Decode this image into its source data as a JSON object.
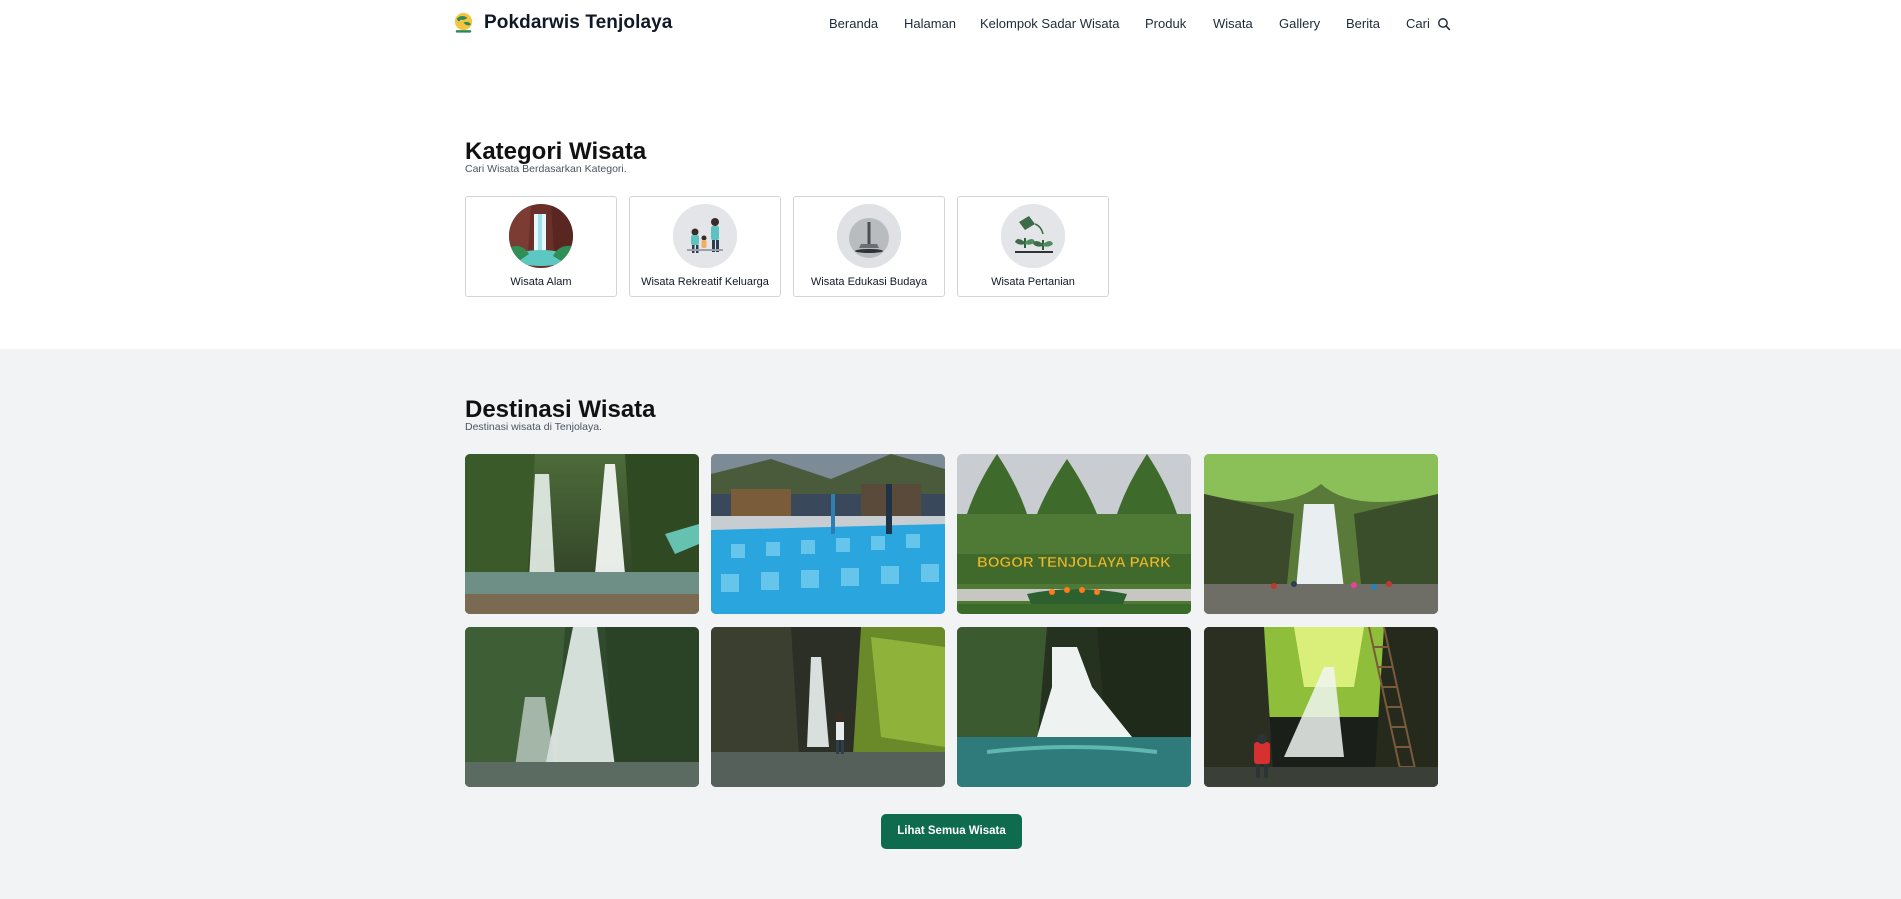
{
  "brand": {
    "name": "Pokdarwis Tenjolaya",
    "logo_icon": "globe-leaf-icon"
  },
  "nav": {
    "items": [
      "Beranda",
      "Halaman",
      "Kelompok Sadar Wisata",
      "Produk",
      "Wisata",
      "Gallery",
      "Berita",
      "Cari"
    ],
    "search_icon": "search-icon"
  },
  "kategori": {
    "title": "Kategori Wisata",
    "subtitle": "Cari Wisata Berdasarkan Kategori.",
    "items": [
      {
        "label": "Wisata Alam",
        "icon": "waterfall-icon"
      },
      {
        "label": "Wisata Rekreatif Keluarga",
        "icon": "family-icon"
      },
      {
        "label": "Wisata Edukasi Budaya",
        "icon": "culture-icon"
      },
      {
        "label": "Wisata Pertanian",
        "icon": "plant-icon"
      }
    ]
  },
  "destinasi": {
    "title": "Destinasi Wisata",
    "subtitle": "Destinasi wisata di Tenjolaya.",
    "photos": [
      {
        "scene": "twin-waterfall-photo"
      },
      {
        "scene": "swimming-pool-photo"
      },
      {
        "scene": "bogor-tenjolaya-park-photo",
        "sign_text": "BOGOR TENJOLAYA PARK"
      },
      {
        "scene": "waterfall-crowd-photo"
      },
      {
        "scene": "jungle-waterfall-photo"
      },
      {
        "scene": "canyon-hiker-photo"
      },
      {
        "scene": "cascade-pool-photo"
      },
      {
        "scene": "cave-waterfall-photo"
      }
    ],
    "cta_label": "Lihat Semua Wisata"
  },
  "colors": {
    "accent": "#0f6b4e",
    "section_bg": "#f2f3f5",
    "card_border": "#d1d5db"
  }
}
